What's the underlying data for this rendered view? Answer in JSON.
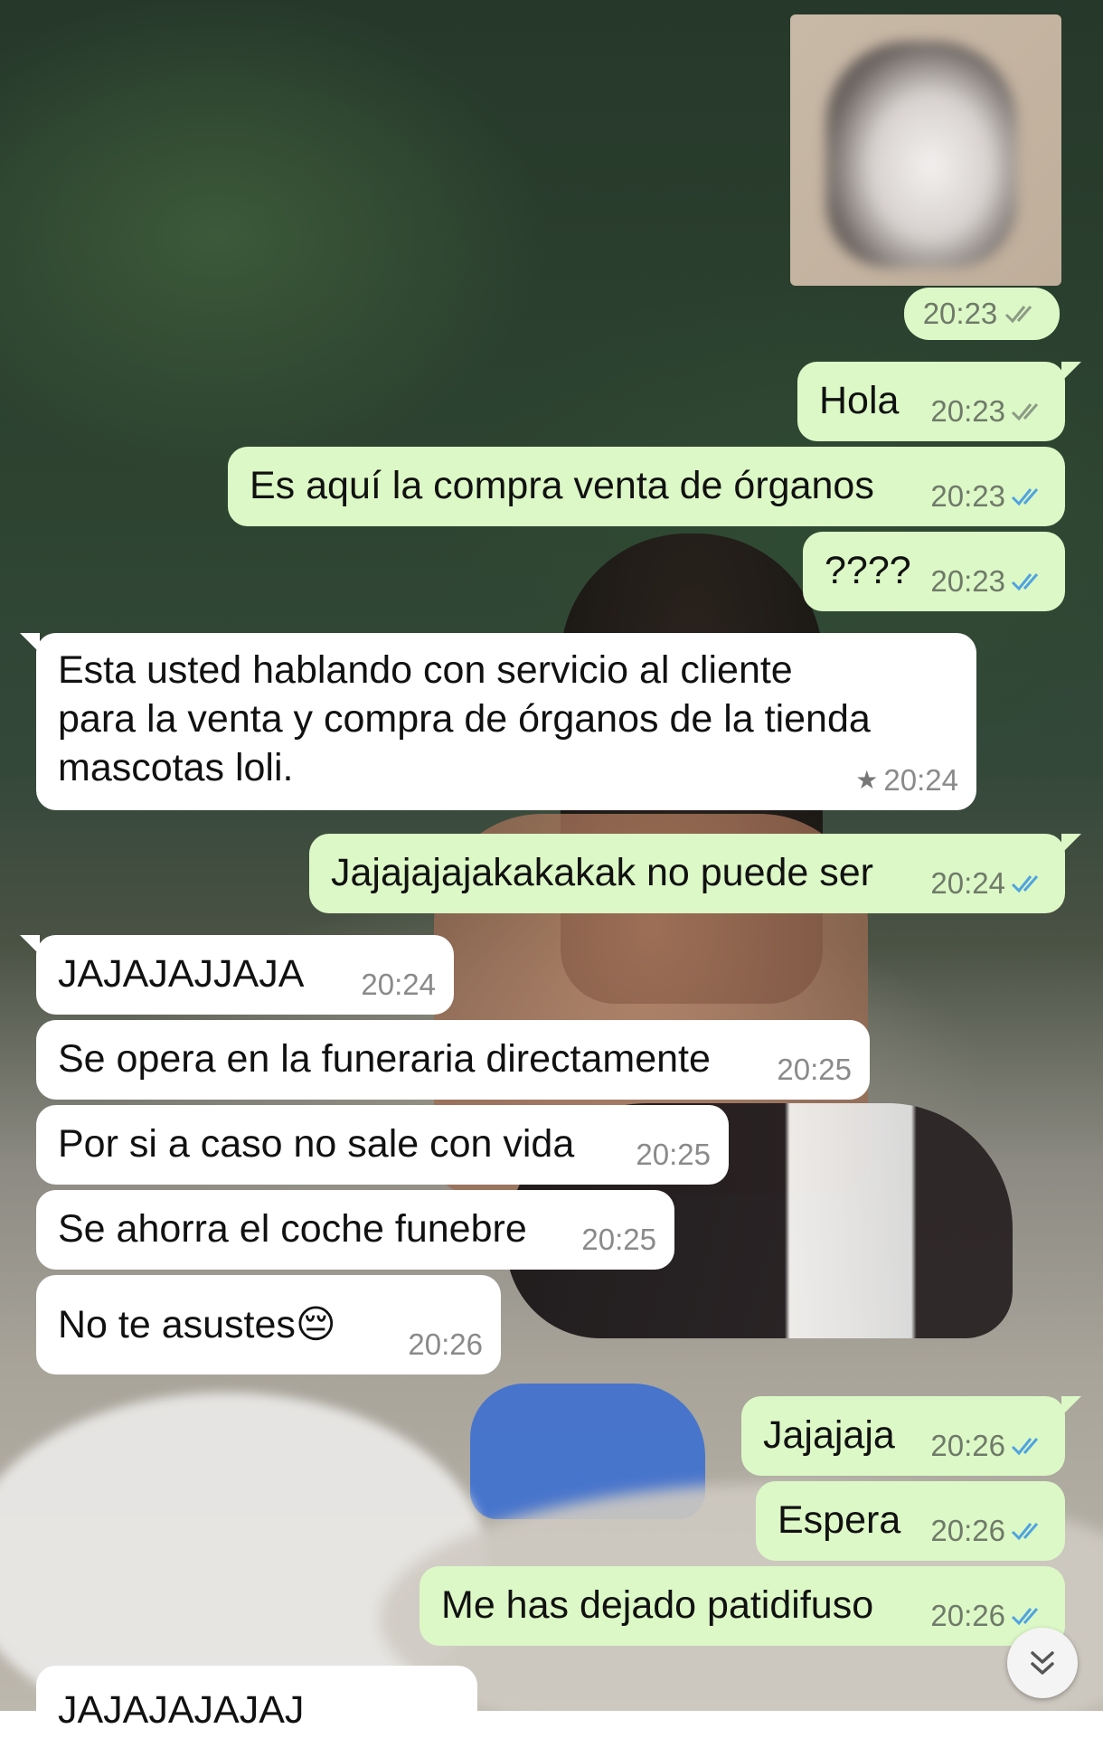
{
  "colors": {
    "outgoing_bubble": "#dcf8c6",
    "incoming_bubble": "#ffffff",
    "read_ticks": "#4fa3e0",
    "delivered_ticks": "#8b9b86"
  },
  "messages": [
    {
      "dir": "out",
      "type": "image",
      "image_desc_icon": "cat-photo",
      "time": "20:23",
      "ticks": "delivered"
    },
    {
      "dir": "out",
      "text": "Hola",
      "time": "20:23",
      "ticks": "delivered"
    },
    {
      "dir": "out",
      "text": "Es aquí la compra venta de órganos",
      "time": "20:23",
      "ticks": "read"
    },
    {
      "dir": "out",
      "text": "????",
      "time": "20:23",
      "ticks": "read"
    },
    {
      "dir": "in",
      "text_lines": [
        "Esta usted hablando con servicio al cliente",
        "para la venta y compra de órganos de la tienda",
        "mascotas loli."
      ],
      "time": "20:24",
      "starred": true
    },
    {
      "dir": "out",
      "text": "Jajajajajakakakak no puede ser",
      "time": "20:24",
      "ticks": "read"
    },
    {
      "dir": "in",
      "text": "JAJAJAJJAJA",
      "time": "20:24"
    },
    {
      "dir": "in",
      "text": "Se opera en la funeraria directamente",
      "time": "20:25"
    },
    {
      "dir": "in",
      "text": "Por si a caso no sale con vida",
      "time": "20:25"
    },
    {
      "dir": "in",
      "text": "Se ahorra el coche funebre",
      "time": "20:25"
    },
    {
      "dir": "in",
      "text": "No te asustes😔",
      "time": "20:26"
    },
    {
      "dir": "out",
      "text": "Jajajaja",
      "time": "20:26",
      "ticks": "read"
    },
    {
      "dir": "out",
      "text": "Espera",
      "time": "20:26",
      "ticks": "read"
    },
    {
      "dir": "out",
      "text": "Me has dejado patidifuso",
      "time": "20:26",
      "ticks": "read"
    },
    {
      "dir": "in",
      "text": "JAJAJAJAJAJ",
      "time": "",
      "partial": true
    }
  ],
  "scroll_button_icon": "double-chevron-down-icon"
}
